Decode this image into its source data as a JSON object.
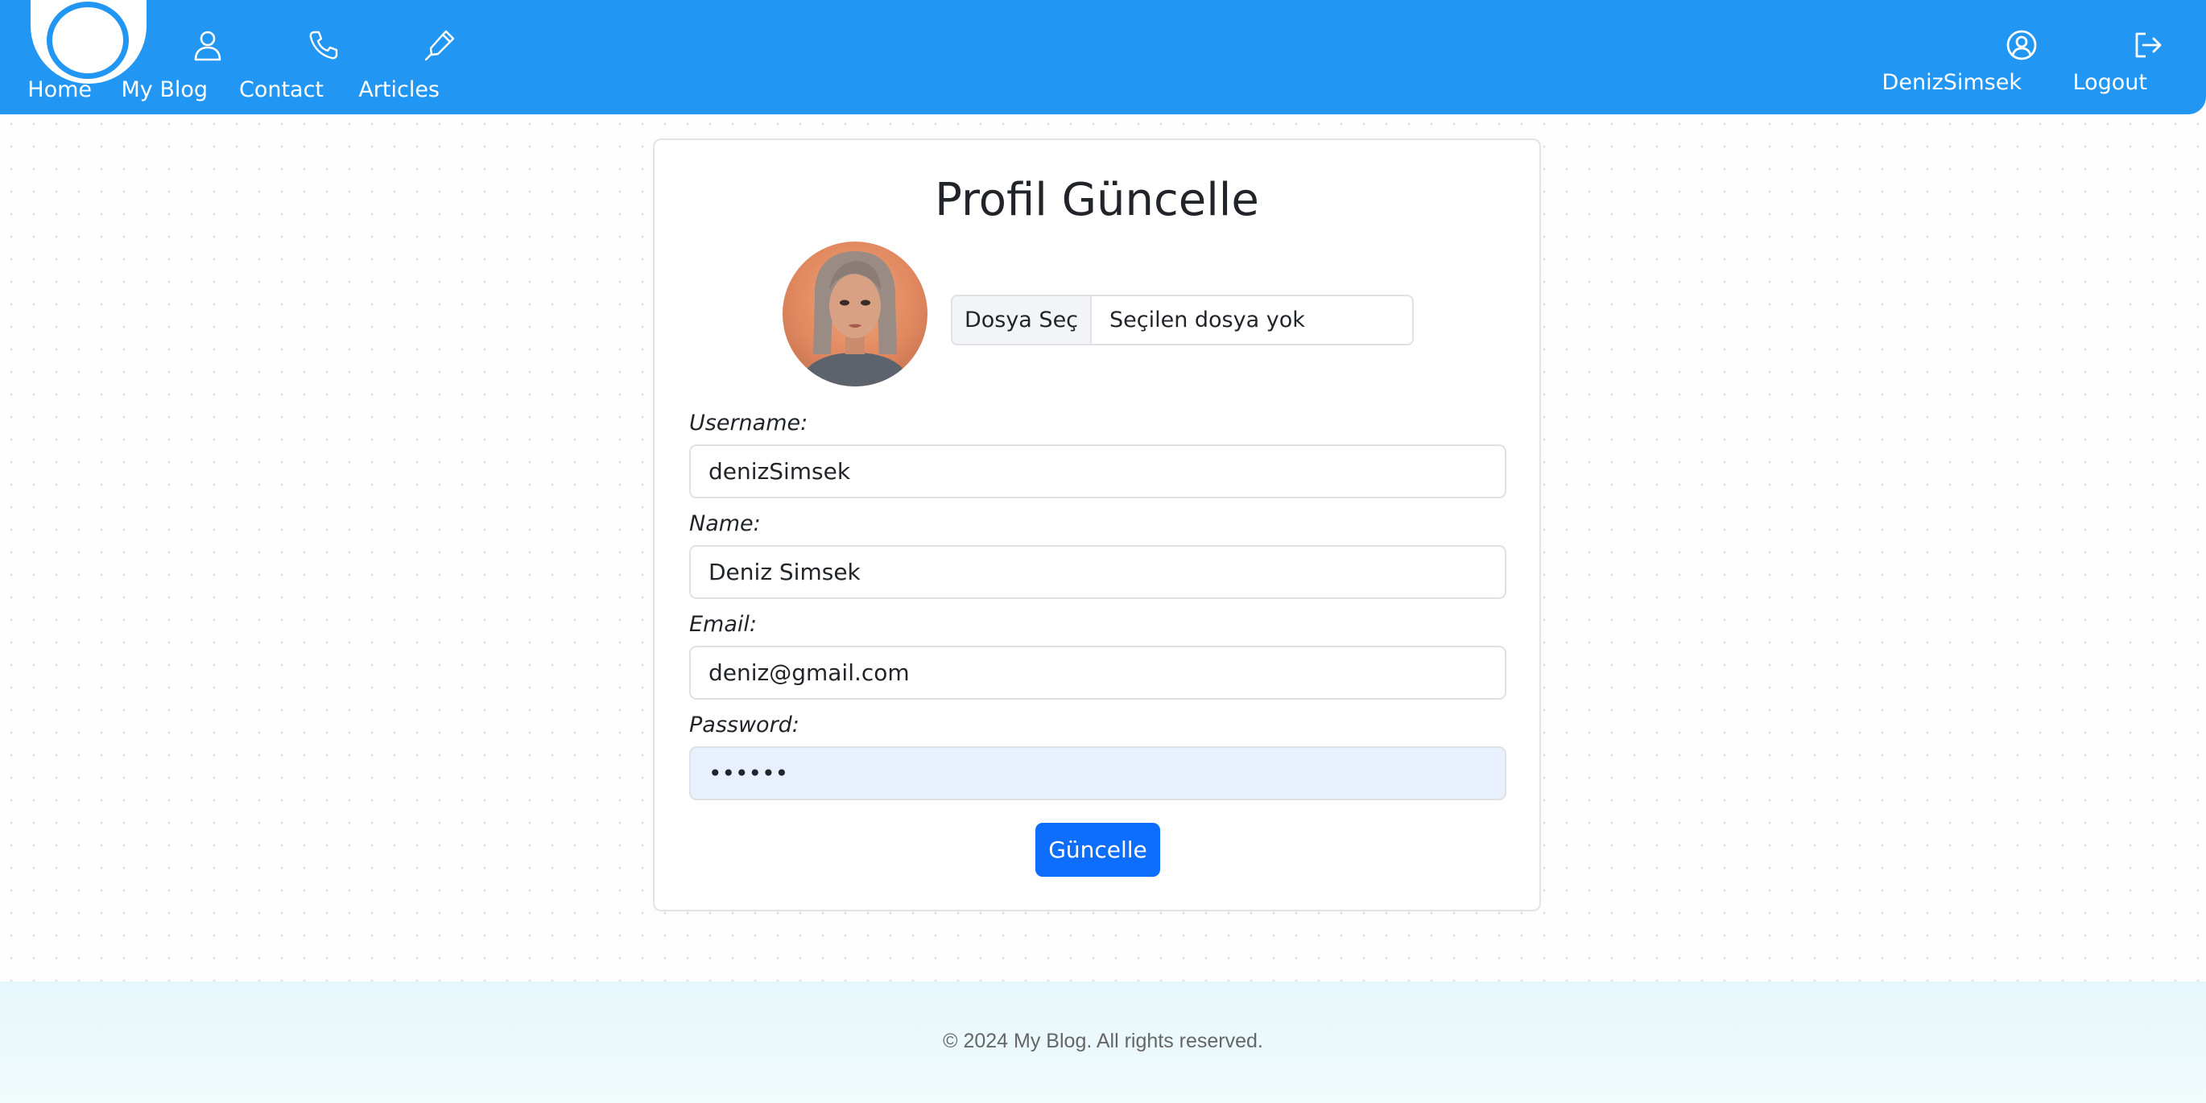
{
  "nav": {
    "left_items": [
      {
        "label": "Home",
        "icon": "logo-circle"
      },
      {
        "label": "My Blog",
        "icon": "user-icon"
      },
      {
        "label": "Contact",
        "icon": "phone-icon"
      },
      {
        "label": "Articles",
        "icon": "pen-nib-icon"
      }
    ],
    "right_items": [
      {
        "label": "DenizSimsek",
        "icon": "user-circle-icon"
      },
      {
        "label": "Logout",
        "icon": "logout-icon"
      }
    ]
  },
  "form": {
    "title": "Profil Güncelle",
    "file_button_label": "Dosya Seç",
    "file_status": "Seçilen dosya yok",
    "fields": [
      {
        "label": "Username:",
        "value": "denizSimsek"
      },
      {
        "label": "Name:",
        "value": "Deniz Simsek"
      },
      {
        "label": "Email:",
        "value": "deniz@gmail.com"
      },
      {
        "label": "Password:",
        "value": "••••••"
      }
    ],
    "submit_label": "Güncelle"
  },
  "footer": {
    "text": "© 2024 My Blog. All rights reserved."
  },
  "colors": {
    "navbar": "#2196f3",
    "primary_button": "#0d6efd",
    "autofill_bg": "#e8f0fe"
  }
}
